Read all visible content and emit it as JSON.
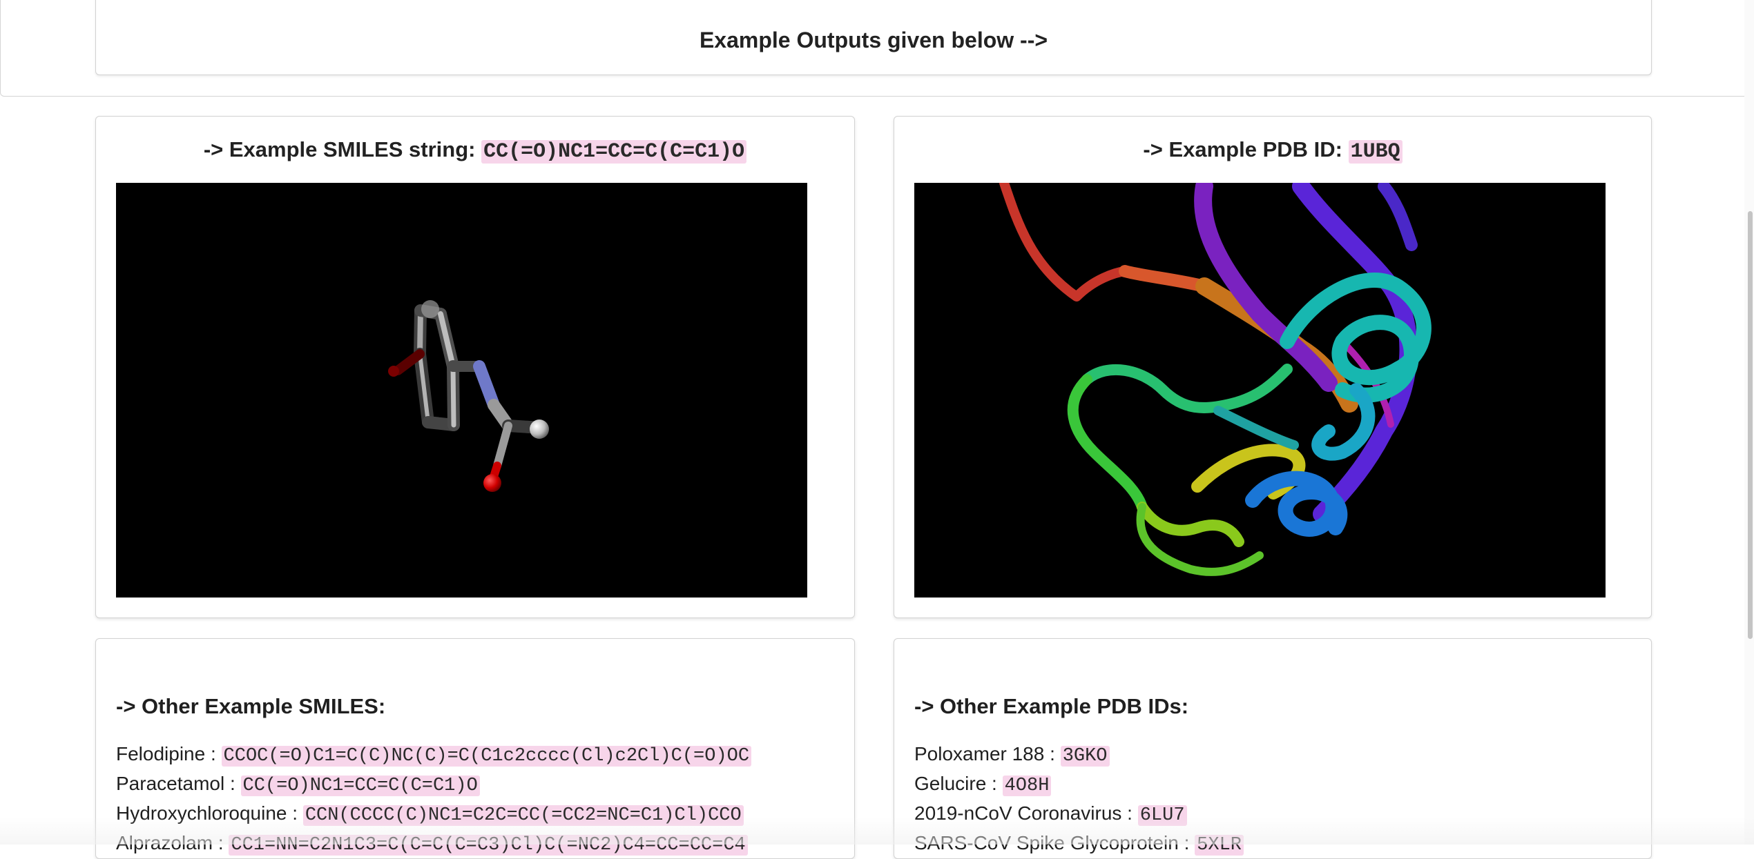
{
  "outputs_banner": {
    "title": "Example Outputs given below -->"
  },
  "smiles_example": {
    "heading_prefix": "-> Example SMILES string: ",
    "smiles": "CC(=O)NC1=CC=C(C=C1)O"
  },
  "pdb_example": {
    "heading_prefix": "-> Example PDB ID: ",
    "pdb_id": "1UBQ"
  },
  "other_smiles": {
    "title": "-> Other Example SMILES:",
    "items": [
      {
        "name": "Felodipine",
        "sep": " : ",
        "value": "CCOC(=O)C1=C(C)NC(C)=C(C1c2cccc(Cl)c2Cl)C(=O)OC"
      },
      {
        "name": "Paracetamol",
        "sep": " : ",
        "value": "CC(=O)NC1=CC=C(C=C1)O"
      },
      {
        "name": "Hydroxychloroquine",
        "sep": " : ",
        "value": "CCN(CCCC(C)NC1=C2C=CC(=CC2=NC=C1)Cl)CCO"
      },
      {
        "name": "Alprazolam",
        "sep": " : ",
        "value": "CC1=NN=C2N1C3=C(C=C(C=C3)Cl)C(=NC2)C4=CC=CC=C4"
      }
    ]
  },
  "other_pdb": {
    "title": "-> Other Example PDB IDs:",
    "items": [
      {
        "name": "Poloxamer 188",
        "sep": " : ",
        "value": "3GKO"
      },
      {
        "name": "Gelucire",
        "sep": " : ",
        "value": "4O8H"
      },
      {
        "name": "2019-nCoV Coronavirus",
        "sep": " : ",
        "value": "6LU7"
      },
      {
        "name": "SARS-CoV Spike Glycoprotein",
        "sep": " : ",
        "value": "5XLR"
      }
    ]
  },
  "colors": {
    "code_highlight": "#f7d5ea",
    "viewer_background": "#000000"
  }
}
